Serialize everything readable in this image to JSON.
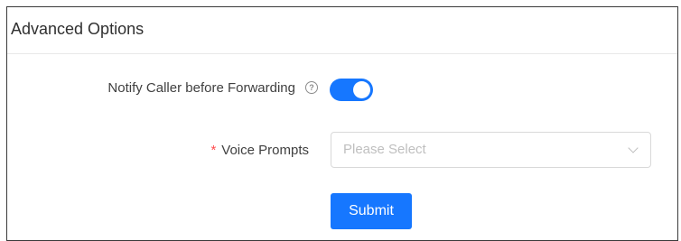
{
  "panel": {
    "title": "Advanced Options"
  },
  "notify_field": {
    "label": "Notify Caller before Forwarding",
    "help_icon": "question-circle-icon",
    "help_glyph": "?",
    "toggle_on": true
  },
  "voice_field": {
    "required_mark": "*",
    "label": "Voice Prompts",
    "placeholder": "Please Select",
    "chevron_icon": "chevron-down-icon"
  },
  "actions": {
    "submit_label": "Submit"
  },
  "colors": {
    "accent": "#1677ff",
    "required": "#ff4d4f",
    "border": "#d9d9d9",
    "placeholder": "#bfbfbf"
  }
}
